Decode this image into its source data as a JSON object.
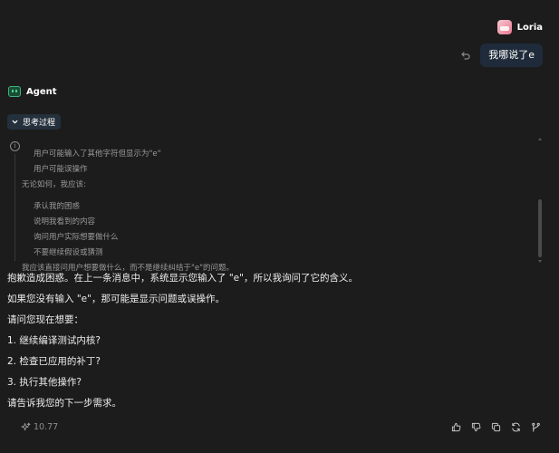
{
  "user": {
    "name": "Loria",
    "message": "我哪说了e"
  },
  "agent": {
    "name": "Agent",
    "thinking_toggle_label": "思考过程",
    "thinking_lines": [
      {
        "text": "用户可能输入了其他字符但显示为\"e\"",
        "indent": true
      },
      {
        "text": "用户可能误操作",
        "indent": true
      },
      {
        "text": "无论如何，我应该:",
        "indent": false
      },
      {
        "text": "承认我的困惑",
        "indent": true
      },
      {
        "text": "说明我看到的内容",
        "indent": true
      },
      {
        "text": "询问用户实际想要做什么",
        "indent": true
      },
      {
        "text": "不要继续假设或猜测",
        "indent": true
      },
      {
        "text": "我应该直接问用户想要做什么，而不是继续纠结于\"e\"的问题。",
        "indent": false
      }
    ],
    "answer_paragraphs": [
      "抱歉造成困惑。在上一条消息中，系统显示您输入了 \"e\"，所以我询问了它的含义。",
      "如果您没有输入 \"e\"，那可能是显示问题或误操作。",
      "请问您现在想要：",
      "1. 继续编译测试内核?",
      "2. 检查已应用的补丁?",
      "3. 执行其他操作?",
      "请告诉我您的下一步需求。"
    ]
  },
  "footer": {
    "credits": "10.77"
  },
  "icons": {
    "thinking_info": "info-icon",
    "credits": "sparkle-icon",
    "actions": [
      "thumbs-up-icon",
      "thumbs-down-icon",
      "copy-icon",
      "regenerate-icon",
      "branch-icon"
    ]
  },
  "colors": {
    "background": "#1c1c1c",
    "user_bubble": "#1f2b3a",
    "toggle_bg": "#24303c",
    "agent_accent": "#3fb27f"
  }
}
